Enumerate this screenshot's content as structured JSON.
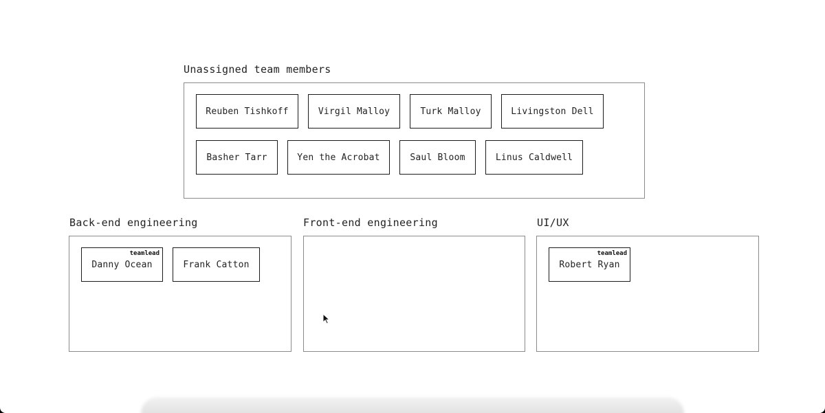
{
  "unassigned": {
    "title": "Unassigned team members",
    "members": [
      "Reuben Tishkoff",
      "Virgil Malloy",
      "Turk Malloy",
      "Livingston Dell",
      "Basher Tarr",
      "Yen the Acrobat",
      "Saul Bloom",
      "Linus Caldwell"
    ]
  },
  "teams": [
    {
      "title": "Back-end engineering",
      "members": [
        {
          "name": "Danny Ocean",
          "badge": "teamlead"
        },
        {
          "name": "Frank Catton",
          "badge": ""
        }
      ]
    },
    {
      "title": "Front-end engineering",
      "members": []
    },
    {
      "title": "UI/UX",
      "members": [
        {
          "name": "Robert Ryan",
          "badge": "teamlead"
        }
      ]
    }
  ],
  "icons": {
    "cursor": "mouse-pointer-icon"
  }
}
